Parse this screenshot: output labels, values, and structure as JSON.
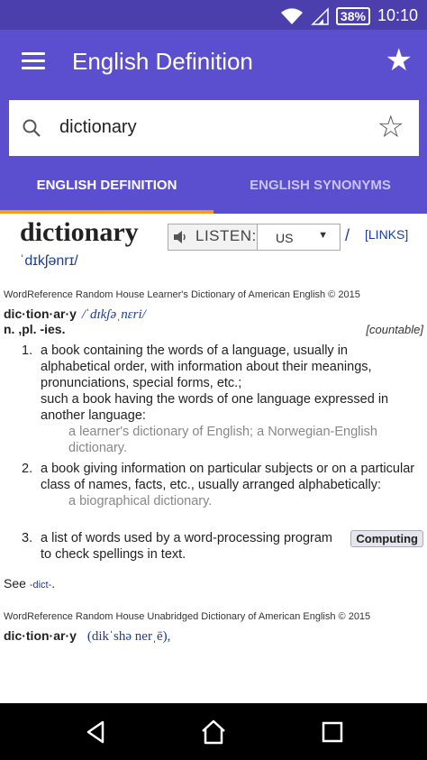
{
  "status": {
    "battery": "38%",
    "time": "10:10"
  },
  "appbar": {
    "title": "English Definition"
  },
  "search": {
    "query": "dictionary"
  },
  "tabs": [
    {
      "label": "ENGLISH DEFINITION",
      "active": true
    },
    {
      "label": "ENGLISH SYNONYMS",
      "active": false
    }
  ],
  "definition": {
    "headword": "dictionary",
    "listen_label": "LISTEN:",
    "accent_selected": "US",
    "slash": "/",
    "links_label": "[LINKS]",
    "ipa": "ˈdɪkʃənrɪ/",
    "source1": "WordReference Random House Learner's Dictionary of American English © 2015",
    "entry1_word": "dic·tion·ar·y",
    "entry1_pron": "/ˈdɪkʃəˌnɛri/",
    "pos": "n. ,pl. -ies.",
    "countable": "[countable]",
    "senses": [
      {
        "num": "1.",
        "text": "a book containing the words of a language, usually in alphabetical order, with information about their meanings, pronunciations, special forms, etc.;",
        "text2": "such a book having the words of one language expressed in another language:",
        "example": "a learner's dictionary of English; a Norwegian-English dictionary."
      },
      {
        "num": "2.",
        "text": "a book giving information on particular subjects or on a particular class of names, facts, etc., usually arranged alphabetically:",
        "example": "a biographical dictionary."
      },
      {
        "num": "3.",
        "text": "a list of words used by a word-processing program to check spellings in text.",
        "badge": "Computing"
      }
    ],
    "see_label": "See",
    "see_ref": "-dict-",
    "see_end": ".",
    "source2": "WordReference Random House Unabridged Dictionary of American English © 2015",
    "entry2_word": "dic·tion·ar·y",
    "entry2_pron": "(dikˈshə nerˌē),"
  },
  "colors": {
    "appbar": "#5b4fcf",
    "statusbar": "#4b3fad",
    "tab_indicator": "#f59c1a",
    "link": "#1a3d9e"
  },
  "icons": [
    "wifi-icon",
    "signal-icon",
    "menu-icon",
    "star-icon",
    "search-icon",
    "star-outline-icon",
    "speaker-icon",
    "back-icon",
    "home-icon",
    "recents-icon"
  ]
}
